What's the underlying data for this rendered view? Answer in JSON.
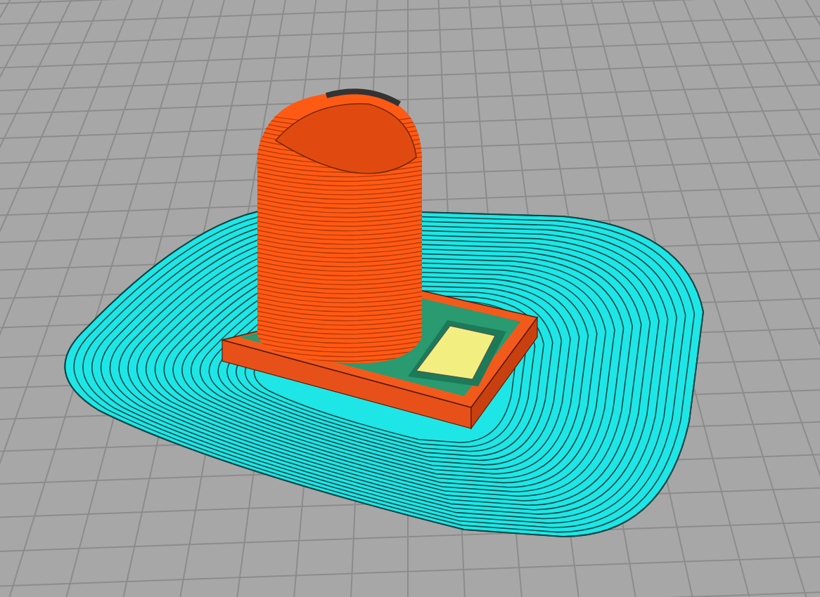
{
  "viewport": {
    "kind": "layer-preview"
  }
}
